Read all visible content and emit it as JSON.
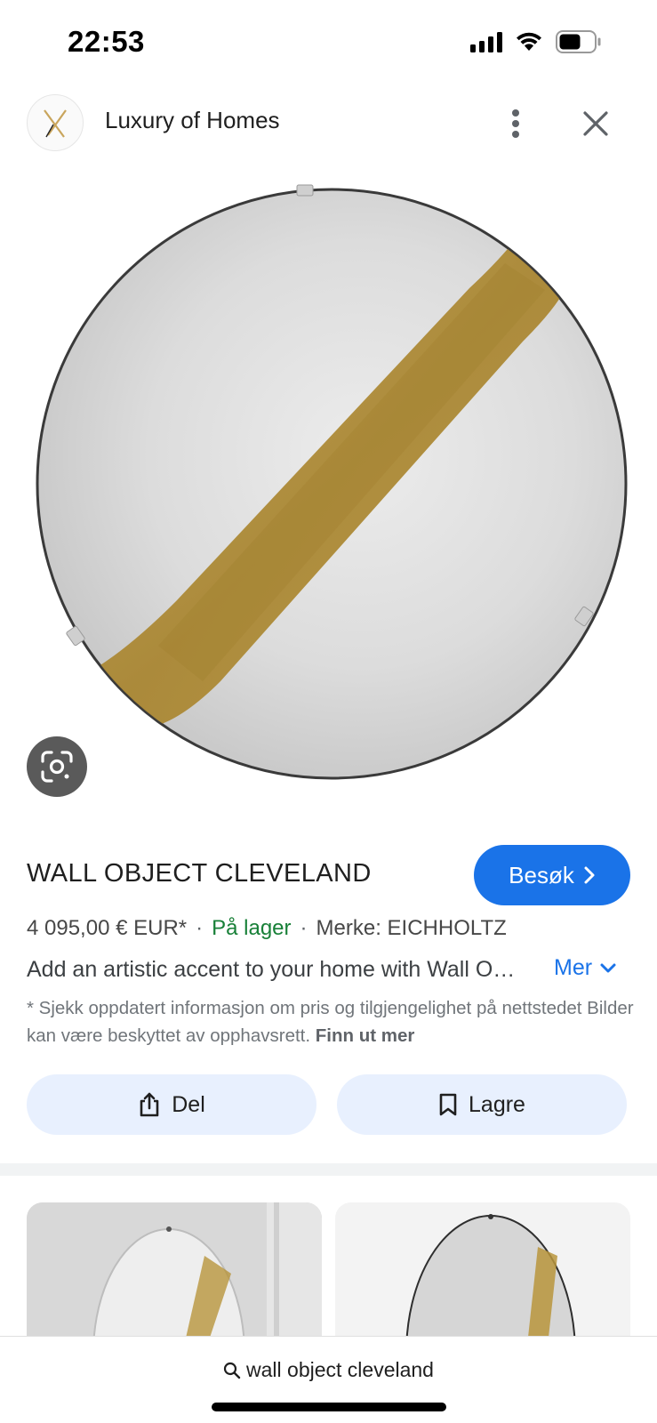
{
  "status_bar": {
    "time": "22:53"
  },
  "header": {
    "site_name": "Luxury of Homes",
    "logo_icon": "luxury-of-homes-logo",
    "more_icon": "more-vert-icon",
    "close_icon": "close-icon"
  },
  "product": {
    "title": "WALL OBJECT CLEVELAND",
    "visit_label": "Besøk",
    "price": "4 095,00 € EUR*",
    "separator": "·",
    "stock": "På lager",
    "brand": "Merke: EICHHOLTZ",
    "description": "Add an artistic accent to your home with Wall Object Cleveland",
    "more_label": "Mer",
    "disclaimer": "* Sjekk oppdatert informasjon om pris og tilgjengelighet på nettstedet Bilder kan være beskyttet av opphavsrett.",
    "learn_more": "Finn ut mer"
  },
  "actions": {
    "share_label": "Del",
    "save_label": "Lagre"
  },
  "search": {
    "query": "wall object cleveland"
  },
  "colors": {
    "accent": "#1a73e8",
    "stock_green": "#188038",
    "chip_bg": "#e8f0fe",
    "brush_gold": "#a8842e"
  }
}
